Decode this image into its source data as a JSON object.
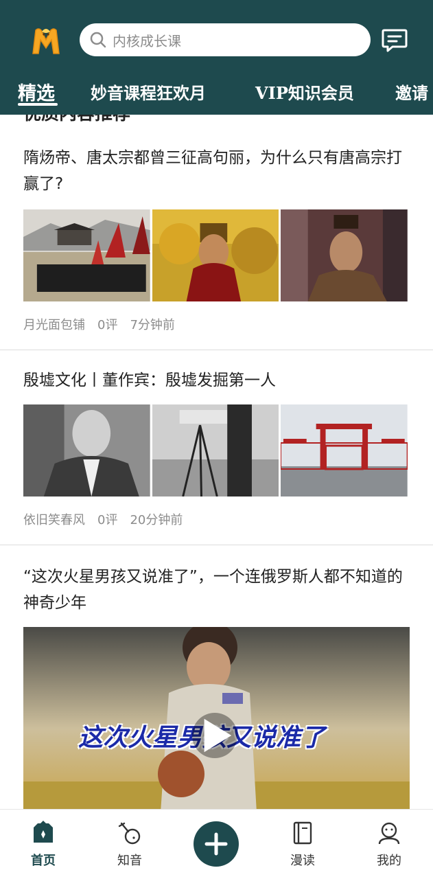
{
  "header": {
    "search_placeholder": "内核成长课",
    "tabs": [
      {
        "label": "精选",
        "active": true
      },
      {
        "label": "妙音课程狂欢月",
        "active": false
      },
      {
        "label": "VIP知识会员",
        "active": false
      },
      {
        "label": "邀请",
        "active": false
      }
    ],
    "brand_color": "#1e4a4e"
  },
  "feed": {
    "section_heading": "优质内容推荐",
    "articles": [
      {
        "title": "隋炀帝、唐太宗都曾三征高句丽，为什么只有唐高宗打赢了?",
        "author": "月光面包铺",
        "comments": "0评",
        "time": "7分钟前"
      },
      {
        "title": "殷墟文化丨董作宾：殷墟发掘第一人",
        "author": "依旧笑春风",
        "comments": "0评",
        "time": "20分钟前"
      },
      {
        "title": "“这次火星男孩又说准了”，一个连俄罗斯人都不知道的神奇少年",
        "video_caption": "这次火星男孩又说准了"
      }
    ]
  },
  "bottom_nav": {
    "items": [
      {
        "label": "首页",
        "icon": "home-icon",
        "active": true
      },
      {
        "label": "知音",
        "icon": "pipa-icon",
        "active": false
      },
      {
        "label": "",
        "icon": "add-icon",
        "active": false
      },
      {
        "label": "漫读",
        "icon": "book-icon",
        "active": false
      },
      {
        "label": "我的",
        "icon": "profile-icon",
        "active": false
      }
    ]
  }
}
